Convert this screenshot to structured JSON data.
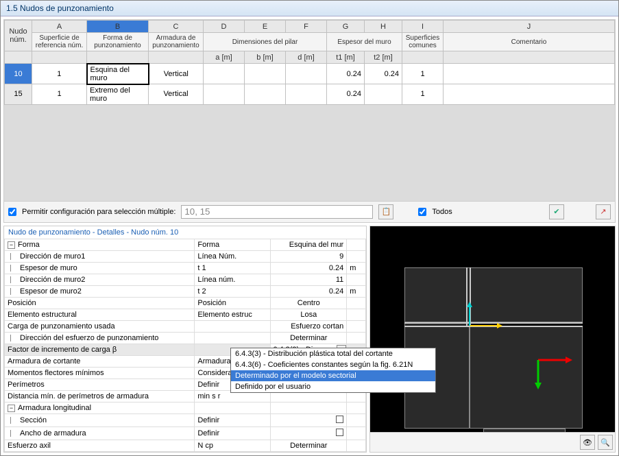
{
  "title": "1.5 Nudos de punzonamiento",
  "columns": {
    "letters": [
      "A",
      "B",
      "C",
      "D",
      "E",
      "F",
      "G",
      "H",
      "I",
      "J"
    ],
    "nudo": "Nudo\nnúm.",
    "a": "Superficie de\nreferencia núm.",
    "b": "Forma de\npunzonamiento",
    "c": "Armadura de\npunzonamiento",
    "d_group": "Dimensiones del pilar",
    "d": "a [m]",
    "e": "b [m]",
    "f": "d [m]",
    "g_group": "Espesor del muro",
    "g": "t1 [m]",
    "h": "t2 [m]",
    "i": "Superficies\ncomunes",
    "j": "Comentario"
  },
  "rows": [
    {
      "num": "10",
      "a": "1",
      "b": "Esquina del muro",
      "c": "Vertical",
      "d": "",
      "e": "",
      "f": "",
      "g": "0.24",
      "h": "0.24",
      "i": "1",
      "j": ""
    },
    {
      "num": "15",
      "a": "1",
      "b": "Extremo del muro",
      "c": "Vertical",
      "d": "",
      "e": "",
      "f": "",
      "g": "0.24",
      "h": "",
      "i": "1",
      "j": ""
    }
  ],
  "opt": {
    "permit_label": "Permitir configuración para selección múltiple:",
    "permit_value": "10, 15",
    "todos_label": "Todos"
  },
  "details_title": "Nudo de punzonamiento - Detalles - Nudo núm.  10",
  "details": {
    "forma": {
      "label": "Forma",
      "col2": "Forma",
      "val": "Esquina del mur"
    },
    "dir1": {
      "label": "Dirección de muro1",
      "col2": "Línea Núm.",
      "val": "9"
    },
    "esp1": {
      "label": "Espesor de muro",
      "col2": "t 1",
      "val": "0.24",
      "u": "m"
    },
    "dir2": {
      "label": "Dirección de muro2",
      "col2": "Línea núm.",
      "val": "11"
    },
    "esp2": {
      "label": "Espesor de muro2",
      "col2": "t 2",
      "val": "0.24",
      "u": "m"
    },
    "pos": {
      "label": "Posición",
      "col2": "Posición",
      "val": "Centro"
    },
    "elem": {
      "label": "Elemento estructural",
      "col2": "Elemento estruc",
      "val": "Losa"
    },
    "carga": {
      "label": "Carga de punzonamiento usada",
      "col2": "",
      "val": "Esfuerzo cortan"
    },
    "diresf": {
      "label": "Dirección del esfuerzo de punzonamiento",
      "col2": "",
      "val": "Determinar"
    },
    "factor": {
      "label": "Factor de incremento de carga β",
      "col2": "",
      "val": "6.4.3(3) - Dis"
    },
    "armcort": {
      "label": "Armadura de cortante",
      "col2": "Armadura"
    },
    "momfl": {
      "label": "Momentos flectores mínimos",
      "col2": "Considerar"
    },
    "perim": {
      "label": "Perímetros",
      "col2": "Definir"
    },
    "distmin": {
      "label": "Distancia mín. de perímetros de armadura",
      "col2": "min s r"
    },
    "armlong": {
      "label": "Armadura longitudinal"
    },
    "seccion": {
      "label": "Sección",
      "col2": "Definir"
    },
    "ancho": {
      "label": "Ancho de armadura",
      "col2": "Definir"
    },
    "esfaxil": {
      "label": "Esfuerzo axil",
      "col2": "N cp",
      "val": "Determinar"
    }
  },
  "dropdown": {
    "opt1": "6.4.3(3) - Distribución plástica total del cortante",
    "opt2": "6.4.3(6) - Coeficientes constantes según la fig. 6.21N",
    "opt3": "Determinado por el modelo sectorial",
    "opt4": "Definido por el usuario"
  }
}
